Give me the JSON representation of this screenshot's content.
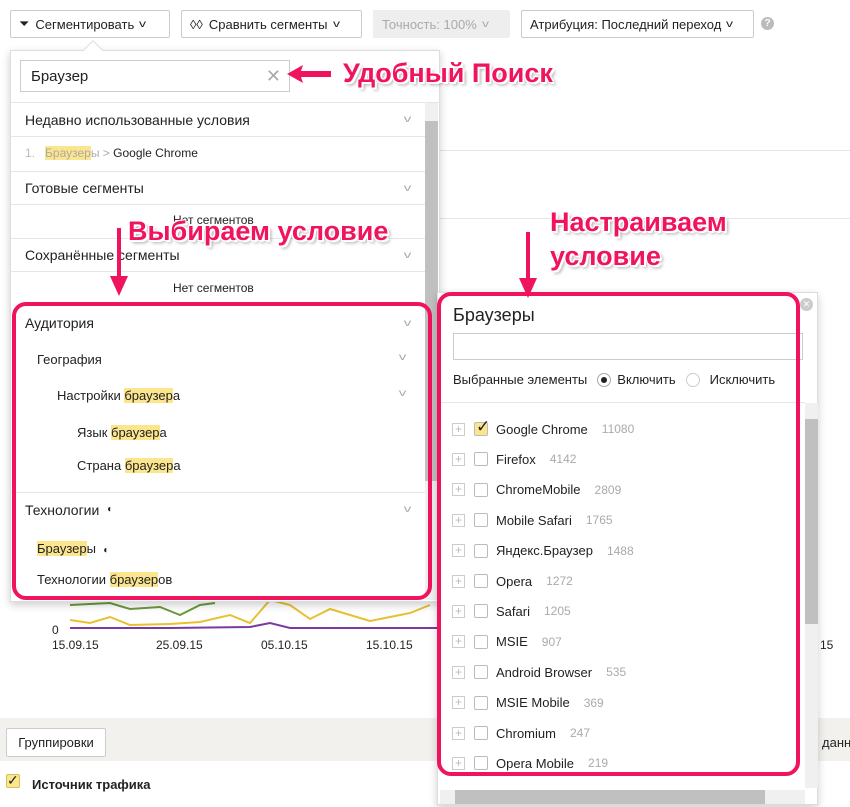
{
  "toolbar": {
    "segment": "Сегментировать",
    "compare": "Сравнить сегменты",
    "accuracy": "Точность: 100%",
    "attribution": "Атрибуция: Последний переход",
    "help": "?"
  },
  "search": {
    "value": "Браузер"
  },
  "annotations": {
    "search": "Удобный Поиск",
    "choose": "Выбираем условие",
    "configure_1": "Настраиваем",
    "configure_2": "условие",
    "color": "#f0135e"
  },
  "left": {
    "recent": "Недавно использованные условия",
    "recent_item": {
      "num": "1.",
      "hl": "Браузер",
      "rest": "ы",
      "sep": " > ",
      "value": "Google Chrome"
    },
    "ready": "Готовые сегменты",
    "ready_empty": "Нет сегментов",
    "saved": "Сохранённые сегменты",
    "saved_empty": "Нет сегментов",
    "audience": "Аудитория",
    "geo": "География",
    "browser_settings": {
      "pre": "Настройки ",
      "hl": "браузер",
      "post": "а"
    },
    "lang": {
      "pre": "Язык ",
      "hl": "браузер",
      "post": "а"
    },
    "country": {
      "pre": "Страна ",
      "hl": "браузер",
      "post": "а"
    },
    "tech": "Технологии",
    "browsers": {
      "hl": "Браузер",
      "post": "ы"
    },
    "tech_browsers": {
      "pre": "Технологии ",
      "hl": "браузер",
      "post": "ов"
    }
  },
  "right": {
    "title": "Браузеры",
    "selected_label": "Выбранные элементы",
    "include": "Включить",
    "exclude": "Исключить",
    "items": [
      {
        "name": "Google Chrome",
        "count": "11080",
        "checked": true
      },
      {
        "name": "Firefox",
        "count": "4142"
      },
      {
        "name": "ChromeMobile",
        "count": "2809"
      },
      {
        "name": "Mobile Safari",
        "count": "1765"
      },
      {
        "name": "Яндекс.Браузер",
        "count": "1488"
      },
      {
        "name": "Opera",
        "count": "1272"
      },
      {
        "name": "Safari",
        "count": "1205"
      },
      {
        "name": "MSIE",
        "count": "907"
      },
      {
        "name": "Android Browser",
        "count": "535"
      },
      {
        "name": "MSIE Mobile",
        "count": "369"
      },
      {
        "name": "Chromium",
        "count": "247"
      },
      {
        "name": "Opera Mobile",
        "count": "219"
      }
    ]
  },
  "chart": {
    "zero": "0",
    "dates": [
      "15.09.15",
      "25.09.15",
      "05.10.15",
      "15.10.15"
    ],
    "tail": "15"
  },
  "bottom": {
    "groupings": "Группировки",
    "right_cut": "данн",
    "source": "Источник трафика"
  }
}
